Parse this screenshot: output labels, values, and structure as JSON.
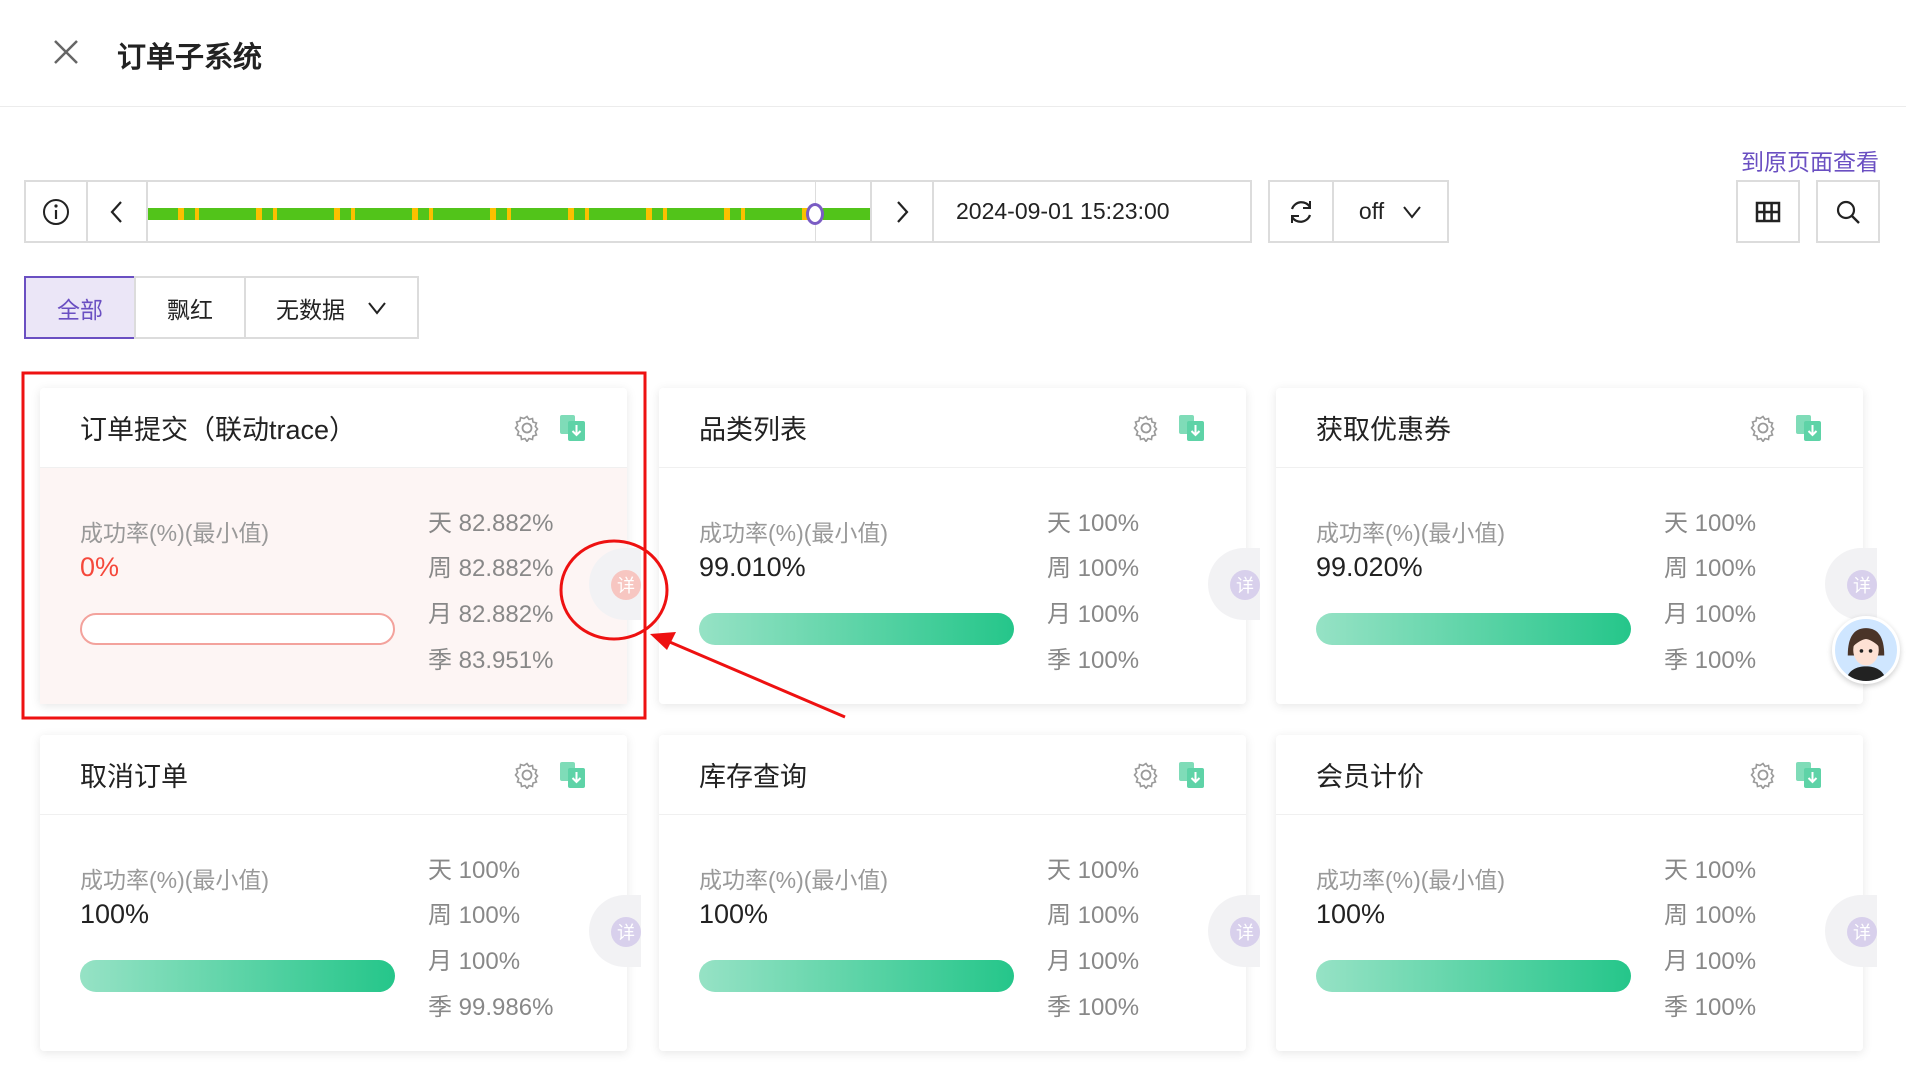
{
  "header": {
    "title": "订单子系统"
  },
  "toolbar": {
    "link": "到原页面查看",
    "datetime": "2024-09-01 15:23:00",
    "refresh_mode": "off"
  },
  "timeline": {
    "position": 0.924,
    "colors": {
      "ok": "#52c41a",
      "warn": "#fac000"
    }
  },
  "filters": [
    {
      "label": "全部",
      "active": true
    },
    {
      "label": "飘红"
    },
    {
      "label": "无数据"
    }
  ],
  "metric_label": "成功率(%)(最小值)",
  "detail_label": "详",
  "cards": [
    {
      "title": "订单提交（联动trace）",
      "value": "0%",
      "progress": 0,
      "status": "red",
      "stats": [
        "天 82.882%",
        "周 82.882%",
        "月 82.882%",
        "季 83.951%"
      ]
    },
    {
      "title": "品类列表",
      "value": "99.010%",
      "progress": 99.01,
      "stats": [
        "天 100%",
        "周 100%",
        "月 100%",
        "季 100%"
      ]
    },
    {
      "title": "获取优惠券",
      "value": "99.020%",
      "progress": 99.02,
      "stats": [
        "天 100%",
        "周 100%",
        "月 100%",
        "季 100%"
      ]
    },
    {
      "title": "取消订单",
      "value": "100%",
      "progress": 100,
      "stats": [
        "天 100%",
        "周 100%",
        "月 100%",
        "季 99.986%"
      ]
    },
    {
      "title": "库存查询",
      "value": "100%",
      "progress": 100,
      "stats": [
        "天 100%",
        "周 100%",
        "月 100%",
        "季 100%"
      ]
    },
    {
      "title": "会员计价",
      "value": "100%",
      "progress": 100,
      "stats": [
        "天 100%",
        "周 100%",
        "月 100%",
        "季 100%"
      ]
    }
  ],
  "annotation_color": "#ee1111"
}
